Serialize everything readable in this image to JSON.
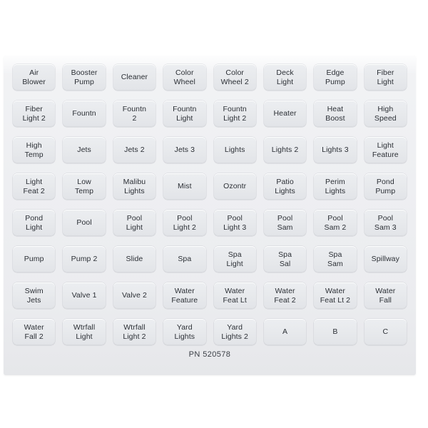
{
  "sheet": {
    "part_number": "PN 520578",
    "colors": {
      "page_background": "#ffffff",
      "sheet_background": "#edeef1",
      "key_background": "#e7e9ec",
      "text": "#2b2f35"
    },
    "grid": {
      "columns": 8,
      "rows": 8
    },
    "keys": [
      {
        "label": "Air\nBlower",
        "name": "air-blower"
      },
      {
        "label": "Booster\nPump",
        "name": "booster-pump"
      },
      {
        "label": "Cleaner",
        "name": "cleaner"
      },
      {
        "label": "Color\nWheel",
        "name": "color-wheel"
      },
      {
        "label": "Color\nWheel 2",
        "name": "color-wheel-2"
      },
      {
        "label": "Deck\nLight",
        "name": "deck-light"
      },
      {
        "label": "Edge\nPump",
        "name": "edge-pump"
      },
      {
        "label": "Fiber\nLight",
        "name": "fiber-light"
      },
      {
        "label": "Fiber\nLight 2",
        "name": "fiber-light-2"
      },
      {
        "label": "Fountn",
        "name": "fountn"
      },
      {
        "label": "Fountn\n2",
        "name": "fountn-2"
      },
      {
        "label": "Fountn\nLight",
        "name": "fountn-light"
      },
      {
        "label": "Fountn\nLight 2",
        "name": "fountn-light-2"
      },
      {
        "label": "Heater",
        "name": "heater"
      },
      {
        "label": "Heat\nBoost",
        "name": "heat-boost"
      },
      {
        "label": "High\nSpeed",
        "name": "high-speed"
      },
      {
        "label": "High\nTemp",
        "name": "high-temp"
      },
      {
        "label": "Jets",
        "name": "jets"
      },
      {
        "label": "Jets 2",
        "name": "jets-2"
      },
      {
        "label": "Jets 3",
        "name": "jets-3"
      },
      {
        "label": "Lights",
        "name": "lights"
      },
      {
        "label": "Lights 2",
        "name": "lights-2"
      },
      {
        "label": "Lights 3",
        "name": "lights-3"
      },
      {
        "label": "Light\nFeature",
        "name": "light-feature"
      },
      {
        "label": "Light\nFeat 2",
        "name": "light-feat-2"
      },
      {
        "label": "Low\nTemp",
        "name": "low-temp"
      },
      {
        "label": "Malibu\nLights",
        "name": "malibu-lights"
      },
      {
        "label": "Mist",
        "name": "mist"
      },
      {
        "label": "Ozontr",
        "name": "ozontr"
      },
      {
        "label": "Patio\nLights",
        "name": "patio-lights"
      },
      {
        "label": "Perim\nLights",
        "name": "perim-lights"
      },
      {
        "label": "Pond\nPump",
        "name": "pond-pump"
      },
      {
        "label": "Pond\nLight",
        "name": "pond-light"
      },
      {
        "label": "Pool",
        "name": "pool"
      },
      {
        "label": "Pool\nLight",
        "name": "pool-light"
      },
      {
        "label": "Pool\nLight 2",
        "name": "pool-light-2"
      },
      {
        "label": "Pool\nLight 3",
        "name": "pool-light-3"
      },
      {
        "label": "Pool\nSam",
        "name": "pool-sam"
      },
      {
        "label": "Pool\nSam 2",
        "name": "pool-sam-2"
      },
      {
        "label": "Pool\nSam 3",
        "name": "pool-sam-3"
      },
      {
        "label": "Pump",
        "name": "pump"
      },
      {
        "label": "Pump 2",
        "name": "pump-2"
      },
      {
        "label": "Slide",
        "name": "slide"
      },
      {
        "label": "Spa",
        "name": "spa"
      },
      {
        "label": "Spa\nLight",
        "name": "spa-light"
      },
      {
        "label": "Spa\nSal",
        "name": "spa-sal"
      },
      {
        "label": "Spa\nSam",
        "name": "spa-sam"
      },
      {
        "label": "Spillway",
        "name": "spillway"
      },
      {
        "label": "Swim\nJets",
        "name": "swim-jets"
      },
      {
        "label": "Valve 1",
        "name": "valve-1"
      },
      {
        "label": "Valve 2",
        "name": "valve-2"
      },
      {
        "label": "Water\nFeature",
        "name": "water-feature"
      },
      {
        "label": "Water\nFeat Lt",
        "name": "water-feat-lt"
      },
      {
        "label": "Water\nFeat 2",
        "name": "water-feat-2"
      },
      {
        "label": "Water\nFeat Lt 2",
        "name": "water-feat-lt-2"
      },
      {
        "label": "Water\nFall",
        "name": "water-fall"
      },
      {
        "label": "Water\nFall 2",
        "name": "water-fall-2"
      },
      {
        "label": "Wtrfall\nLight",
        "name": "wtrfall-light"
      },
      {
        "label": "Wtrfall\nLight 2",
        "name": "wtrfall-light-2"
      },
      {
        "label": "Yard\nLights",
        "name": "yard-lights"
      },
      {
        "label": "Yard\nLights 2",
        "name": "yard-lights-2"
      },
      {
        "label": "A",
        "name": "letter-a"
      },
      {
        "label": "B",
        "name": "letter-b"
      },
      {
        "label": "C",
        "name": "letter-c"
      }
    ]
  }
}
